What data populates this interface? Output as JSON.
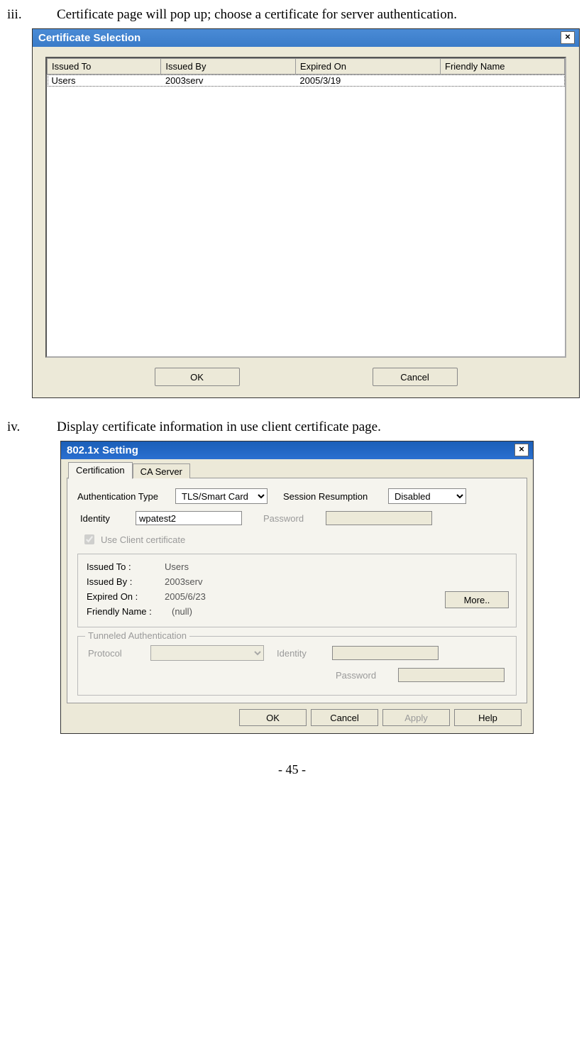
{
  "step3": {
    "num": "iii.",
    "text": "Certificate page will pop up; choose a certificate for server authentication."
  },
  "dialog1": {
    "title": "Certificate Selection",
    "headers": [
      "Issued To",
      "Issued By",
      "Expired On",
      "Friendly Name"
    ],
    "row": {
      "issuedTo": "Users",
      "issuedBy": "2003serv",
      "expiredOn": "2005/3/19",
      "friendlyName": ""
    },
    "ok": "OK",
    "cancel": "Cancel"
  },
  "step4": {
    "num": "iv.",
    "text": "Display certificate information in use client certificate page."
  },
  "dialog2": {
    "title": "802.1x Setting",
    "tabs": {
      "cert": "Certification",
      "ca": "CA Server"
    },
    "authTypeLabel": "Authentication Type",
    "authTypeValue": "TLS/Smart Card",
    "sessionResLabel": "Session Resumption",
    "sessionResValue": "Disabled",
    "identityLabel": "Identity",
    "identityValue": "wpatest2",
    "passwordLabel": "Password",
    "useClientCert": "Use Client certificate",
    "certInfo": {
      "issuedToLabel": "Issued To :",
      "issuedToValue": "Users",
      "issuedByLabel": "Issued By :",
      "issuedByValue": "2003serv",
      "expiredOnLabel": "Expired On :",
      "expiredOnValue": "2005/6/23",
      "friendlyLabel": "Friendly Name :",
      "friendlyValue": "(null)",
      "more": "More.."
    },
    "tunnel": {
      "legend": "Tunneled Authentication",
      "protocolLabel": "Protocol",
      "identityLabel": "Identity",
      "passwordLabel": "Password"
    },
    "buttons": {
      "ok": "OK",
      "cancel": "Cancel",
      "apply": "Apply",
      "help": "Help"
    }
  },
  "pageNumber": "- 45 -"
}
